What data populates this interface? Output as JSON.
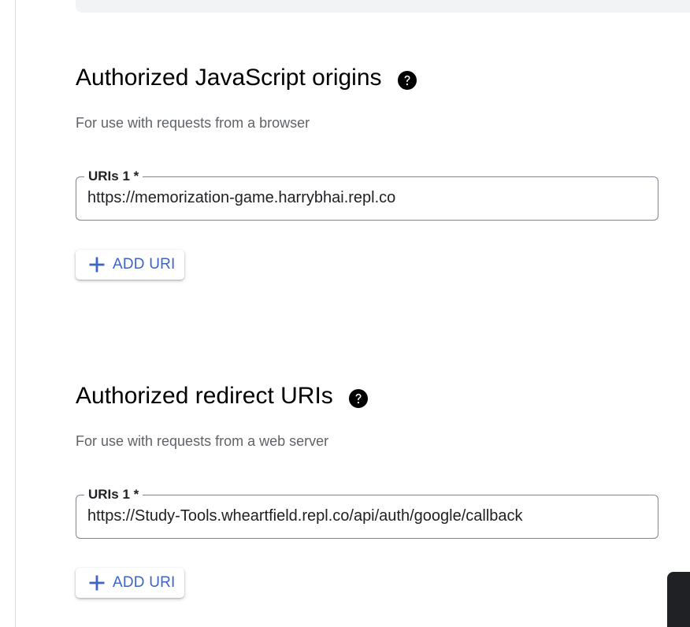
{
  "origins_section": {
    "title": "Authorized JavaScript origins",
    "description": "For use with requests from a browser",
    "help_icon": "help-circle-icon",
    "uri_field": {
      "label": "URIs 1 *",
      "value": "https://memorization-game.harrybhai.repl.co"
    },
    "add_button_label": "ADD URI"
  },
  "redirect_section": {
    "title": "Authorized redirect URIs",
    "description": "For use with requests from a web server",
    "help_icon": "help-circle-icon",
    "uri_field": {
      "label": "URIs 1 *",
      "value": "https://Study-Tools.wheartfield.repl.co/api/auth/google/callback"
    },
    "add_button_label": "ADD URI"
  },
  "colors": {
    "accent": "#3c64c8",
    "text_primary": "#000000",
    "text_secondary": "#5f6368",
    "field_border": "#80868b",
    "banner_bg": "#f1f3f4"
  },
  "icons": {
    "add": "plus-icon",
    "help": "help-circle-icon"
  }
}
